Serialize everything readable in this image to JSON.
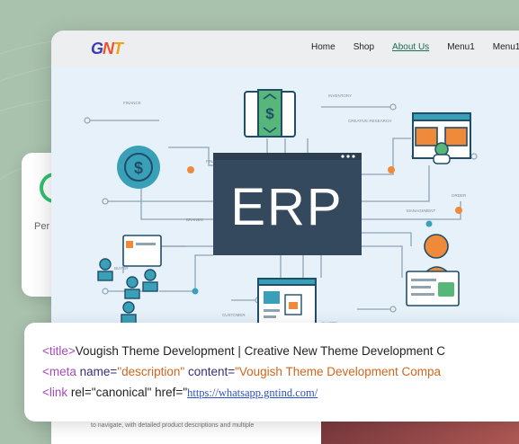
{
  "logo": {
    "part1": "G",
    "part2": "N",
    "part3": "T"
  },
  "nav": {
    "items": [
      "Home",
      "Shop",
      "About Us",
      "Menu1",
      "Menu1"
    ],
    "active_index": 2
  },
  "back_card": {
    "label": "Per"
  },
  "hero": {
    "title": "ERP",
    "labels": {
      "finance_top": "FINANCE",
      "finance_mid": "FINANCE",
      "inventory": "INVENTORY",
      "creative": "CREATIVE RESEARCH",
      "management": "MANAGEMENT",
      "brands": "BRANDS",
      "people": "PEOPLE",
      "customer": "CUSTOMER",
      "charts": "CHARTS",
      "orders": "ORDER",
      "buyer": "BUYER"
    }
  },
  "under": {
    "text": "to navigate, with detailed product descriptions and multiple"
  },
  "code": {
    "line1": {
      "open": "<title>",
      "text": "Vougish Theme Development | Creative New Theme Development C"
    },
    "line2": {
      "open": "<meta ",
      "name_attr": "name=",
      "name_val": "\"description\"",
      "content_attr": " content=",
      "content_val": "\"Vougish Theme Development Compa"
    },
    "line3": {
      "open": "<link ",
      "rel": "rel=\"canonical\" href=\"",
      "url": "https://whatsapp.gntind.com/"
    }
  },
  "colors": {
    "accent": "#1c6b52",
    "erp_box": "#34495e",
    "orange": "#f08a3b",
    "teal": "#3aa0b8"
  }
}
